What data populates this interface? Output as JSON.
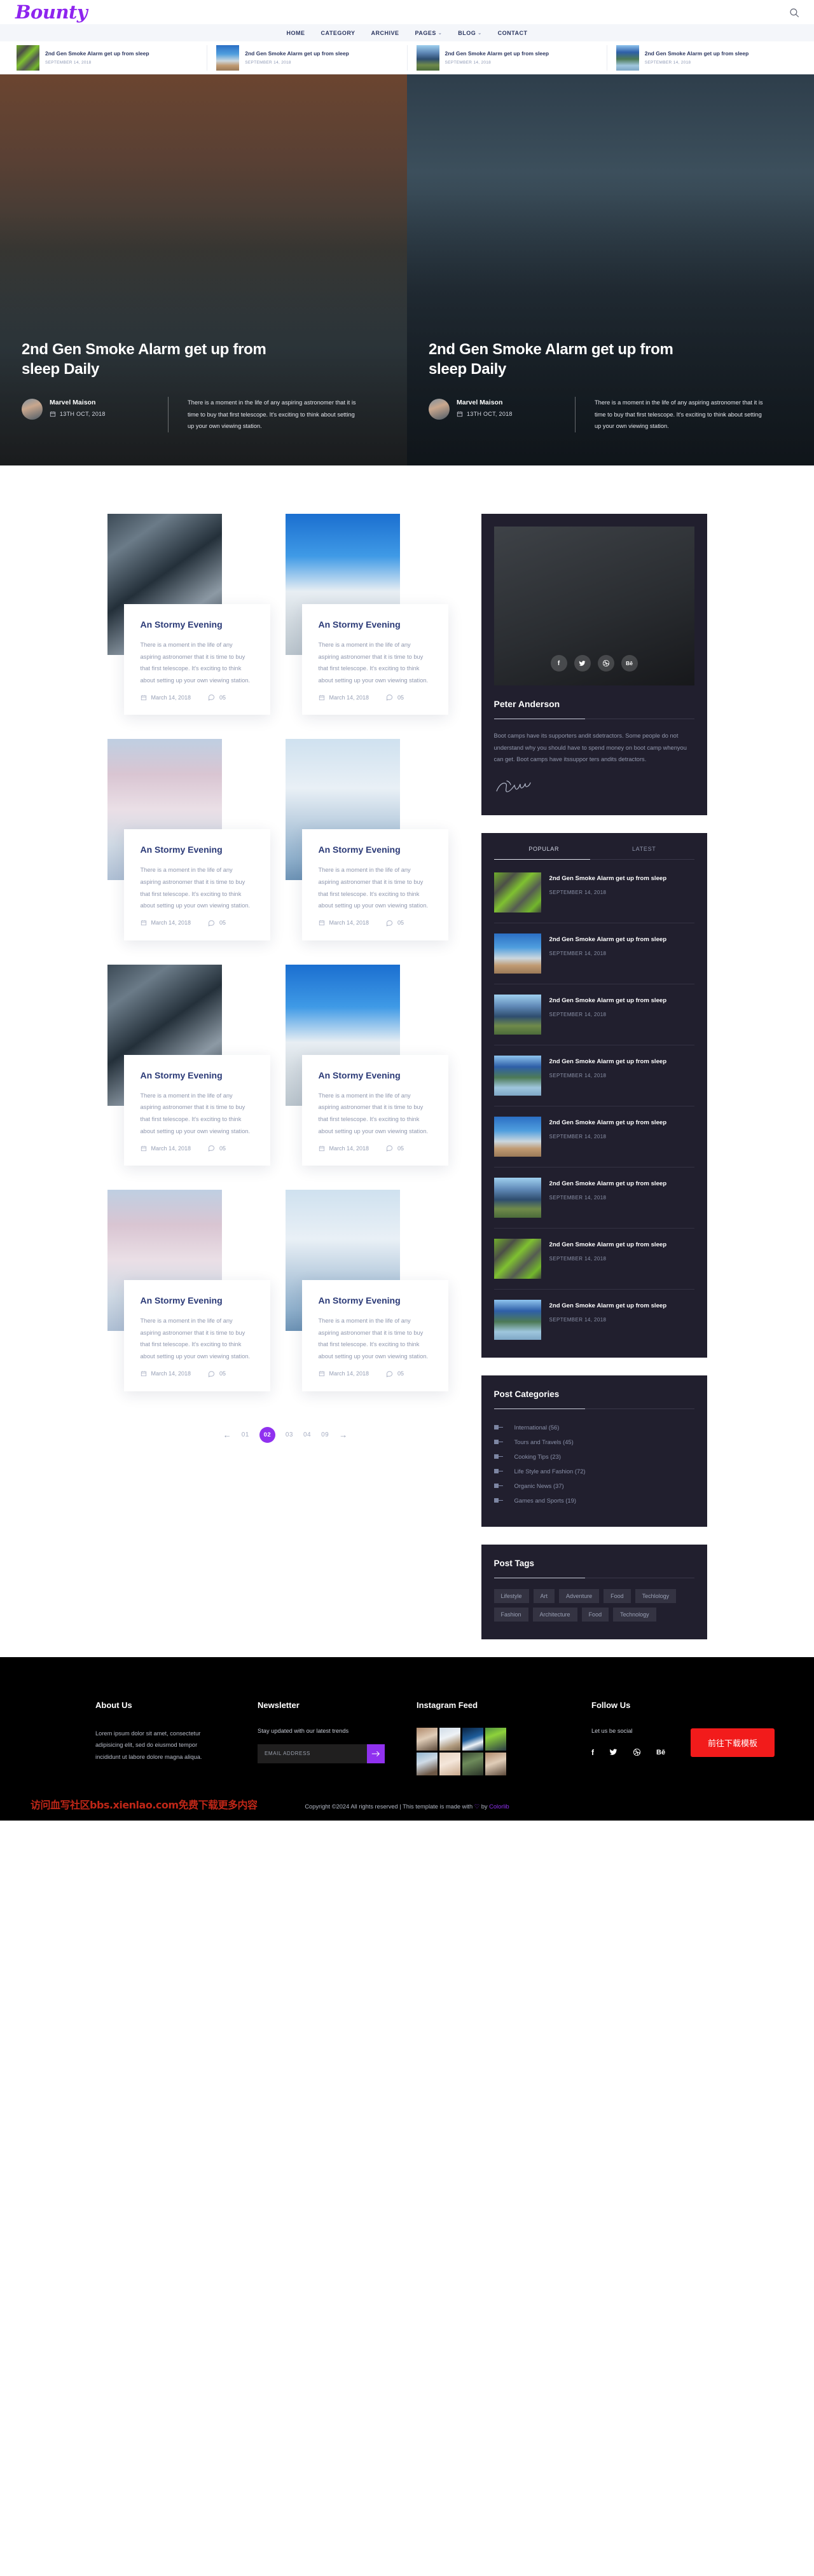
{
  "brand": {
    "name": "Bounty",
    "accent": "#9031ef"
  },
  "header": {
    "search_icon": "search-icon",
    "nav": [
      {
        "label": "HOME",
        "has_caret": false
      },
      {
        "label": "CATEGORY",
        "has_caret": false
      },
      {
        "label": "ARCHIVE",
        "has_caret": false
      },
      {
        "label": "PAGES",
        "has_caret": true
      },
      {
        "label": "BLOG",
        "has_caret": true
      },
      {
        "label": "CONTACT",
        "has_caret": false
      }
    ]
  },
  "trending": [
    {
      "title": "2nd Gen Smoke Alarm get up from sleep",
      "date": "SEPTEMBER 14, 2018"
    },
    {
      "title": "2nd Gen Smoke Alarm get up from sleep",
      "date": "SEPTEMBER 14, 2018"
    },
    {
      "title": "2nd Gen Smoke Alarm get up from sleep",
      "date": "SEPTEMBER 14, 2018"
    },
    {
      "title": "2nd Gen Smoke Alarm get up from sleep",
      "date": "SEPTEMBER 14, 2018"
    }
  ],
  "hero": [
    {
      "title": "2nd Gen Smoke Alarm get up from sleep Daily",
      "author": "Marvel Maison",
      "date": "13TH OCT, 2018",
      "excerpt": "There is a moment in the life of any aspiring astronomer that it is time to buy that first telescope. It's exciting to think about setting up your own viewing station."
    },
    {
      "title": "2nd Gen Smoke Alarm get up from sleep Daily",
      "author": "Marvel Maison",
      "date": "13TH OCT, 2018",
      "excerpt": "There is a moment in the life of any aspiring astronomer that it is time to buy that first telescope. It's exciting to think about setting up your own viewing station."
    }
  ],
  "posts": [
    {
      "title": "An Stormy Evening",
      "text": "There is a moment in the life of any aspiring astronomer that it is time to buy that first telescope. It's exciting to think about setting up your own viewing station.",
      "date": "March 14, 2018",
      "comments": "05"
    },
    {
      "title": "An Stormy Evening",
      "text": "There is a moment in the life of any aspiring astronomer that it is time to buy that first telescope. It's exciting to think about setting up your own viewing station.",
      "date": "March 14, 2018",
      "comments": "05"
    },
    {
      "title": "An Stormy Evening",
      "text": "There is a moment in the life of any aspiring astronomer that it is time to buy that first telescope. It's exciting to think about setting up your own viewing station.",
      "date": "March 14, 2018",
      "comments": "05"
    },
    {
      "title": "An Stormy Evening",
      "text": "There is a moment in the life of any aspiring astronomer that it is time to buy that first telescope. It's exciting to think about setting up your own viewing station.",
      "date": "March 14, 2018",
      "comments": "05"
    },
    {
      "title": "An Stormy Evening",
      "text": "There is a moment in the life of any aspiring astronomer that it is time to buy that first telescope. It's exciting to think about setting up your own viewing station.",
      "date": "March 14, 2018",
      "comments": "05"
    },
    {
      "title": "An Stormy Evening",
      "text": "There is a moment in the life of any aspiring astronomer that it is time to buy that first telescope. It's exciting to think about setting up your own viewing station.",
      "date": "March 14, 2018",
      "comments": "05"
    },
    {
      "title": "An Stormy Evening",
      "text": "There is a moment in the life of any aspiring astronomer that it is time to buy that first telescope. It's exciting to think about setting up your own viewing station.",
      "date": "March 14, 2018",
      "comments": "05"
    },
    {
      "title": "An Stormy Evening",
      "text": "There is a moment in the life of any aspiring astronomer that it is time to buy that first telescope. It's exciting to think about setting up your own viewing station.",
      "date": "March 14, 2018",
      "comments": "05"
    }
  ],
  "pagination": {
    "prev": "←",
    "next": "→",
    "pages": [
      "01",
      "02",
      "03",
      "04",
      "09"
    ],
    "current": "02"
  },
  "sidebar": {
    "author": {
      "name": "Peter Anderson",
      "bio": "Boot camps have its supporters andit sdetractors. Some people do not understand why you should have to spend money on boot camp whenyou can get. Boot camps have itssuppor ters andits detractors.",
      "socials": [
        "facebook-icon",
        "twitter-icon",
        "dribbble-icon",
        "behance-icon"
      ]
    },
    "tabs": {
      "items": [
        "POPULAR",
        "LATEST"
      ],
      "active": "POPULAR"
    },
    "trending_posts": [
      {
        "title": "2nd Gen Smoke Alarm get up from sleep",
        "date": "SEPTEMBER 14, 2018"
      },
      {
        "title": "2nd Gen Smoke Alarm get up from sleep",
        "date": "SEPTEMBER 14, 2018"
      },
      {
        "title": "2nd Gen Smoke Alarm get up from sleep",
        "date": "SEPTEMBER 14, 2018"
      },
      {
        "title": "2nd Gen Smoke Alarm get up from sleep",
        "date": "SEPTEMBER 14, 2018"
      },
      {
        "title": "2nd Gen Smoke Alarm get up from sleep",
        "date": "SEPTEMBER 14, 2018"
      },
      {
        "title": "2nd Gen Smoke Alarm get up from sleep",
        "date": "SEPTEMBER 14, 2018"
      },
      {
        "title": "2nd Gen Smoke Alarm get up from sleep",
        "date": "SEPTEMBER 14, 2018"
      },
      {
        "title": "2nd Gen Smoke Alarm get up from sleep",
        "date": "SEPTEMBER 14, 2018"
      }
    ],
    "categories": {
      "heading": "Post Categories",
      "items": [
        "International (56)",
        "Tours and Travels (45)",
        "Cooking Tips (23)",
        "Life Style and Fashion (72)",
        "Organic News (37)",
        "Games and Sports (19)"
      ]
    },
    "tags": {
      "heading": "Post Tags",
      "items": [
        "Lifestyle",
        "Art",
        "Adventure",
        "Food",
        "Techlology",
        "Fashion",
        "Architecture",
        "Food",
        "Technology"
      ]
    }
  },
  "footer": {
    "about": {
      "heading": "About Us",
      "text": "Lorem ipsum dolor sit amet, consectetur adipisicing elit, sed do eiusmod tempor incididunt ut labore dolore magna aliqua."
    },
    "newsletter": {
      "heading": "Newsletter",
      "subtitle": "Stay updated with our latest trends",
      "placeholder": "Email Address",
      "value": "",
      "submit_icon": "arrow-right-icon"
    },
    "instagram": {
      "heading": "Instagram Feed"
    },
    "follow": {
      "heading": "Follow Us",
      "subtitle": "Let us be social",
      "socials": [
        "facebook-icon",
        "twitter-icon",
        "dribbble-icon",
        "behance-icon"
      ]
    },
    "copyright_pre": "Copyright ©2024 All rights reserved | This template is made with ",
    "copyright_by": " by ",
    "copyright_brand": "Colorlib",
    "download_button": "前往下载模板",
    "watermark": "访问血写社区bbs.xienlao.com免费下载更多内容"
  }
}
